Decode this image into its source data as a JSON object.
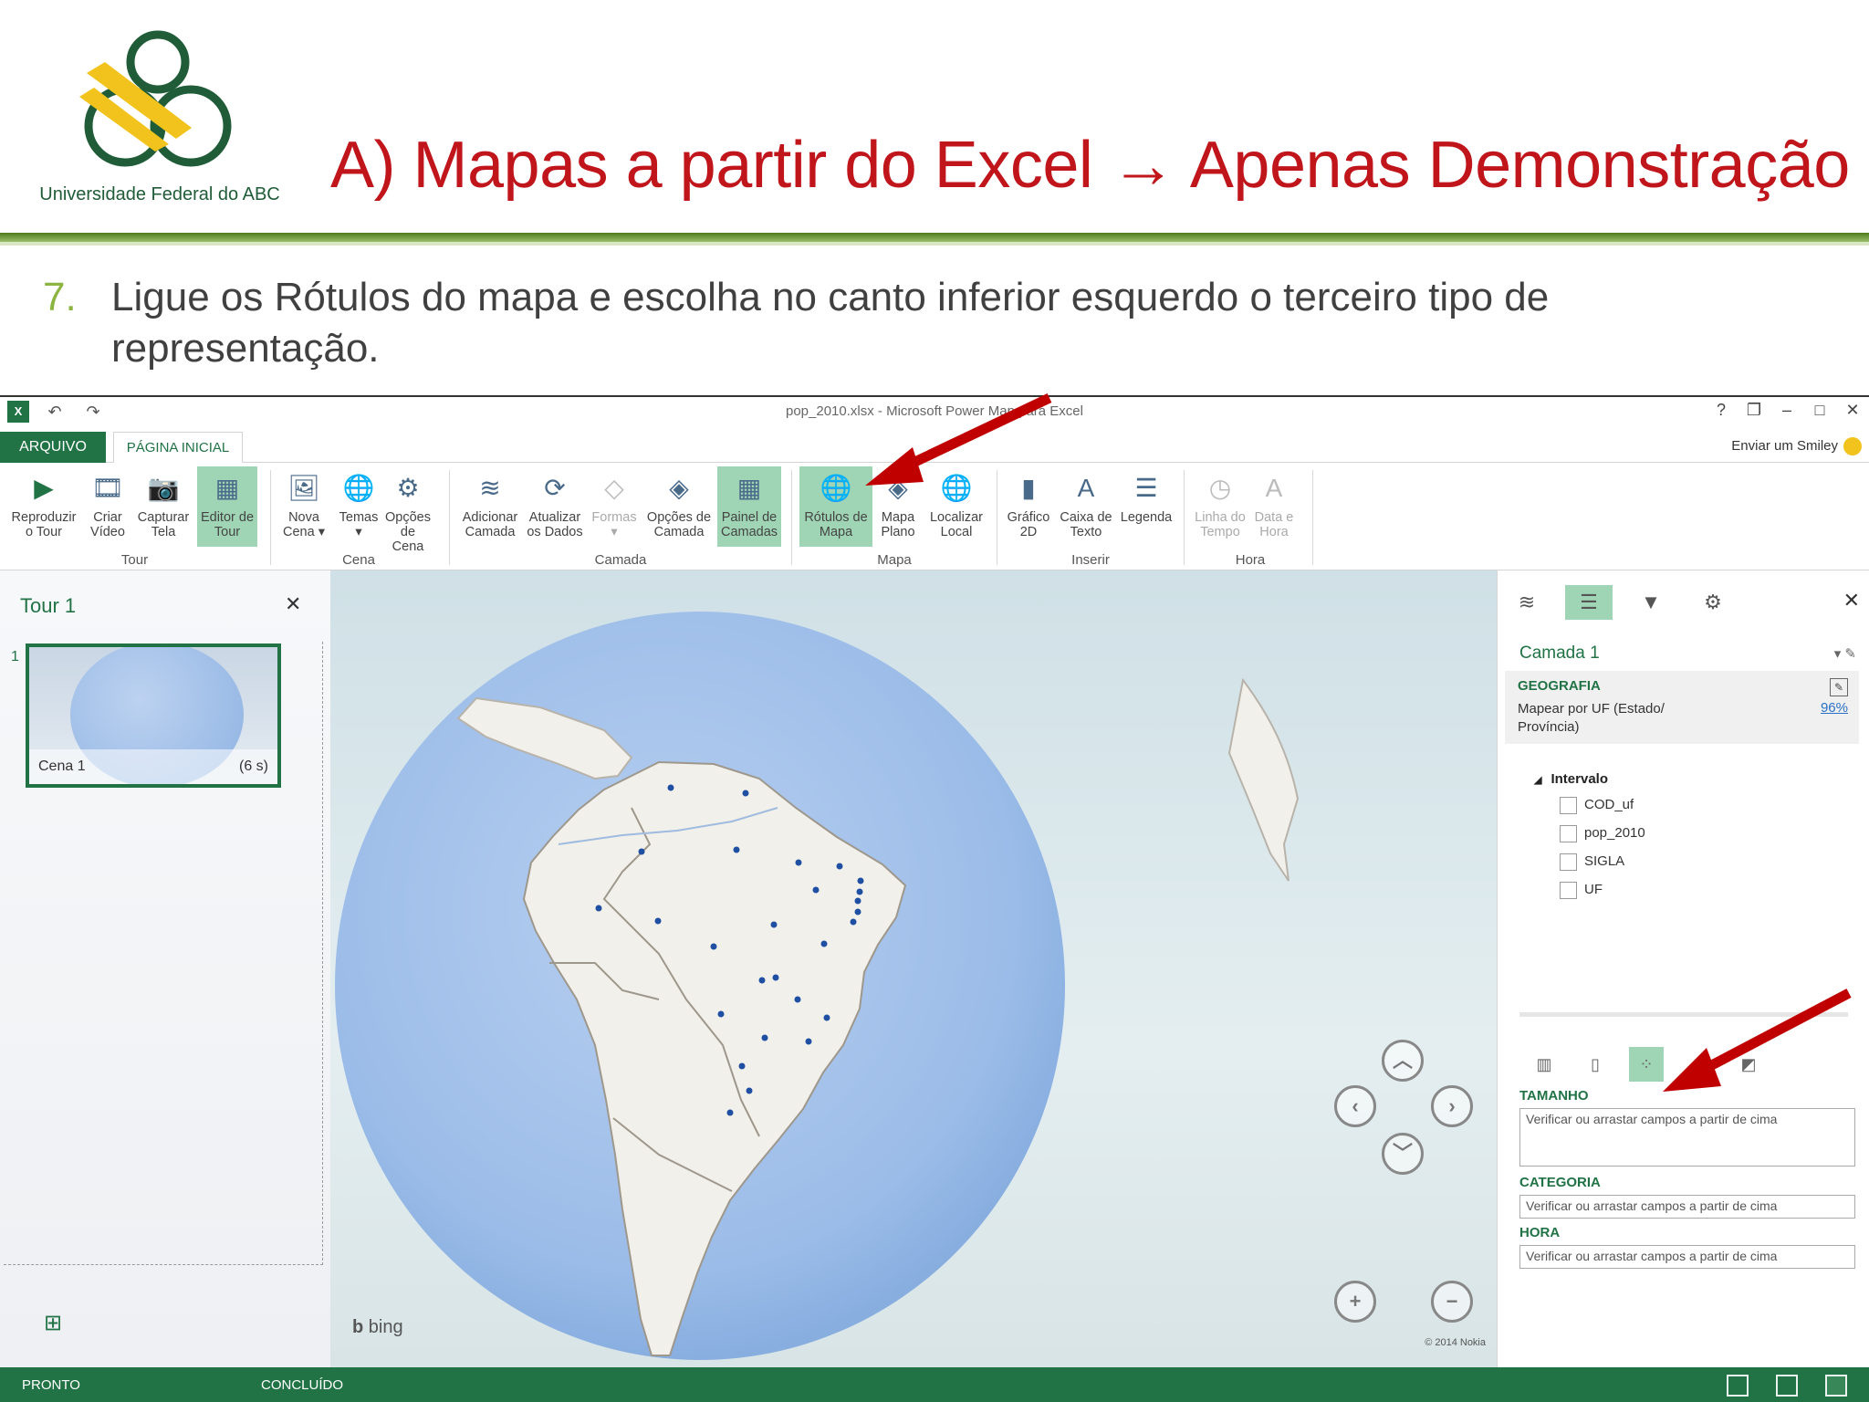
{
  "slide": {
    "logo_text": "Universidade Federal do ABC",
    "title": "A) Mapas a partir do Excel → Apenas Demonstração",
    "bullet_number": "7.",
    "bullet_text": "Ligue os Rótulos do mapa e escolha no canto inferior esquerdo o terceiro tipo de representação."
  },
  "window": {
    "title": "pop_2010.xlsx - Microsoft Power Map para Excel",
    "controls": [
      "?",
      "❐",
      "–",
      "□",
      "✕"
    ]
  },
  "tabs": {
    "file": "ARQUIVO",
    "home": "PÁGINA INICIAL",
    "smiley": "Enviar um Smiley"
  },
  "ribbon": {
    "buttons": [
      {
        "label1": "Reproduzir",
        "label2": "o Tour",
        "icon": "play-icon"
      },
      {
        "label1": "Criar",
        "label2": "Vídeo",
        "icon": "video-icon"
      },
      {
        "label1": "Capturar",
        "label2": "Tela",
        "icon": "camera-icon"
      },
      {
        "label1": "Editor de",
        "label2": "Tour",
        "icon": "tour-editor-icon"
      },
      {
        "label1": "Nova",
        "label2": "Cena ▾",
        "icon": "new-scene-icon"
      },
      {
        "label1": "Temas",
        "label2": "▾",
        "icon": "themes-icon"
      },
      {
        "label1": "Opções",
        "label2": "de Cena",
        "icon": "scene-options-icon"
      },
      {
        "label1": "Adicionar",
        "label2": "Camada",
        "icon": "add-layer-icon"
      },
      {
        "label1": "Atualizar",
        "label2": "os Dados",
        "icon": "refresh-icon"
      },
      {
        "label1": "Formas",
        "label2": "▾",
        "icon": "shapes-icon"
      },
      {
        "label1": "Opções de",
        "label2": "Camada",
        "icon": "layer-options-icon"
      },
      {
        "label1": "Painel de",
        "label2": "Camadas",
        "icon": "layer-pane-icon"
      },
      {
        "label1": "Rótulos de",
        "label2": "Mapa",
        "icon": "map-labels-icon"
      },
      {
        "label1": "Mapa",
        "label2": "Plano",
        "icon": "flat-map-icon"
      },
      {
        "label1": "Localizar",
        "label2": "Local",
        "icon": "find-location-icon"
      },
      {
        "label1": "Gráfico",
        "label2": "2D",
        "icon": "chart-2d-icon"
      },
      {
        "label1": "Caixa de",
        "label2": "Texto",
        "icon": "text-box-icon"
      },
      {
        "label1": "Legenda",
        "label2": "",
        "icon": "legend-icon"
      },
      {
        "label1": "Linha do",
        "label2": "Tempo",
        "icon": "timeline-icon"
      },
      {
        "label1": "Data e",
        "label2": "Hora",
        "icon": "date-time-icon"
      }
    ],
    "groups": [
      "Tour",
      "Cena",
      "Camada",
      "Mapa",
      "Inserir",
      "Hora"
    ]
  },
  "tour_panel": {
    "title": "Tour 1",
    "scene_number": "1",
    "scene_name": "Cena 1",
    "scene_duration": "(6 s)"
  },
  "map": {
    "attribution_logo": "bing",
    "copyright": "© 2014 Nokia"
  },
  "layer_pane": {
    "layer_name": "Camada 1",
    "geo_heading": "GEOGRAFIA",
    "geo_desc": "Mapear por UF (Estado/ Província)",
    "geo_pct": "96%",
    "range_label": "Intervalo",
    "fields": [
      "COD_uf",
      "pop_2010",
      "SIGLA",
      "UF"
    ],
    "wells": [
      {
        "label": "TAMANHO",
        "placeholder": "Verificar ou arrastar campos a partir de cima"
      },
      {
        "label": "CATEGORIA",
        "placeholder": "Verificar ou arrastar campos a partir de cima"
      },
      {
        "label": "HORA",
        "placeholder": "Verificar ou arrastar campos a partir de cima"
      }
    ]
  },
  "status": {
    "left": "PRONTO",
    "middle": "CONCLUÍDO"
  },
  "colors": {
    "accent_green": "#217346",
    "title_red": "#c0151b",
    "arrow_red": "#c00000"
  }
}
